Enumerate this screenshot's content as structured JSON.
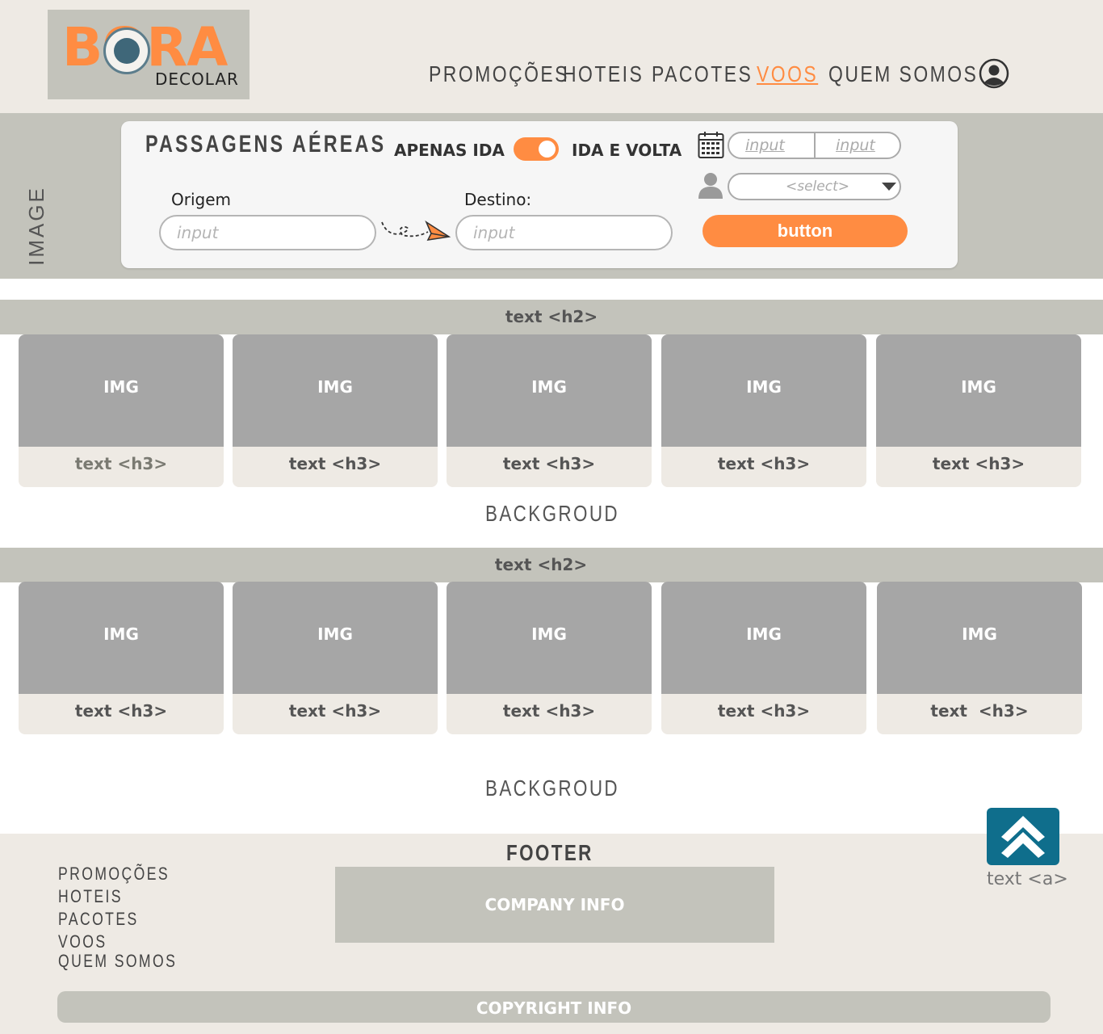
{
  "logo": {
    "word": "BORA",
    "sub": "DECOLAR"
  },
  "nav": {
    "items": [
      {
        "label": "PROMOÇÕES"
      },
      {
        "label": "HOTEIS"
      },
      {
        "label": "PACOTES"
      },
      {
        "label": "VOOS"
      },
      {
        "label": "QUEM SOMOS"
      }
    ],
    "active": "VOOS"
  },
  "hero": {
    "label": "IMAGE",
    "search": {
      "title": "PASSAGENS AÉREAS",
      "one_way_label": "APENAS IDA",
      "round_trip_label": "IDA E VOLTA",
      "origin_label": "Origem",
      "origin_placeholder": "input",
      "destination_label": "Destino:",
      "destination_placeholder": "input",
      "date_from": "input",
      "date_to": "input",
      "passengers_select": "<select>",
      "button_label": "button"
    }
  },
  "sections": [
    {
      "title": "text <h2>",
      "cards": [
        {
          "img": "IMG",
          "title": "text <h3>"
        },
        {
          "img": "IMG",
          "title": "text <h3>"
        },
        {
          "img": "IMG",
          "title": "text <h3>"
        },
        {
          "img": "IMG",
          "title": "text <h3>"
        },
        {
          "img": "IMG",
          "title": "text <h3>"
        }
      ],
      "background_label": "BACKGROUD"
    },
    {
      "title": "text <h2>",
      "cards": [
        {
          "img": "IMG",
          "title": "text <h3>"
        },
        {
          "img": "IMG",
          "title": "text <h3>"
        },
        {
          "img": "IMG",
          "title": "text <h3>"
        },
        {
          "img": "IMG",
          "title": "text <h3>"
        },
        {
          "img": "IMG",
          "title": "text  <h3>"
        }
      ],
      "background_label": "BACKGROUD"
    }
  ],
  "footer": {
    "title": "FOOTER",
    "links": [
      "PROMOÇÕES",
      "HOTEIS",
      "PACOTES",
      "VOOS",
      "QUEM SOMOS"
    ],
    "company_info": "COMPANY INFO",
    "back_to_top_label": "text <a>",
    "copyright": "COPYRIGHT INFO"
  },
  "colors": {
    "accent": "#ff8c42",
    "panel": "#c3c3bb",
    "background": "#eeeae4",
    "top_button": "#0f6e8c"
  }
}
